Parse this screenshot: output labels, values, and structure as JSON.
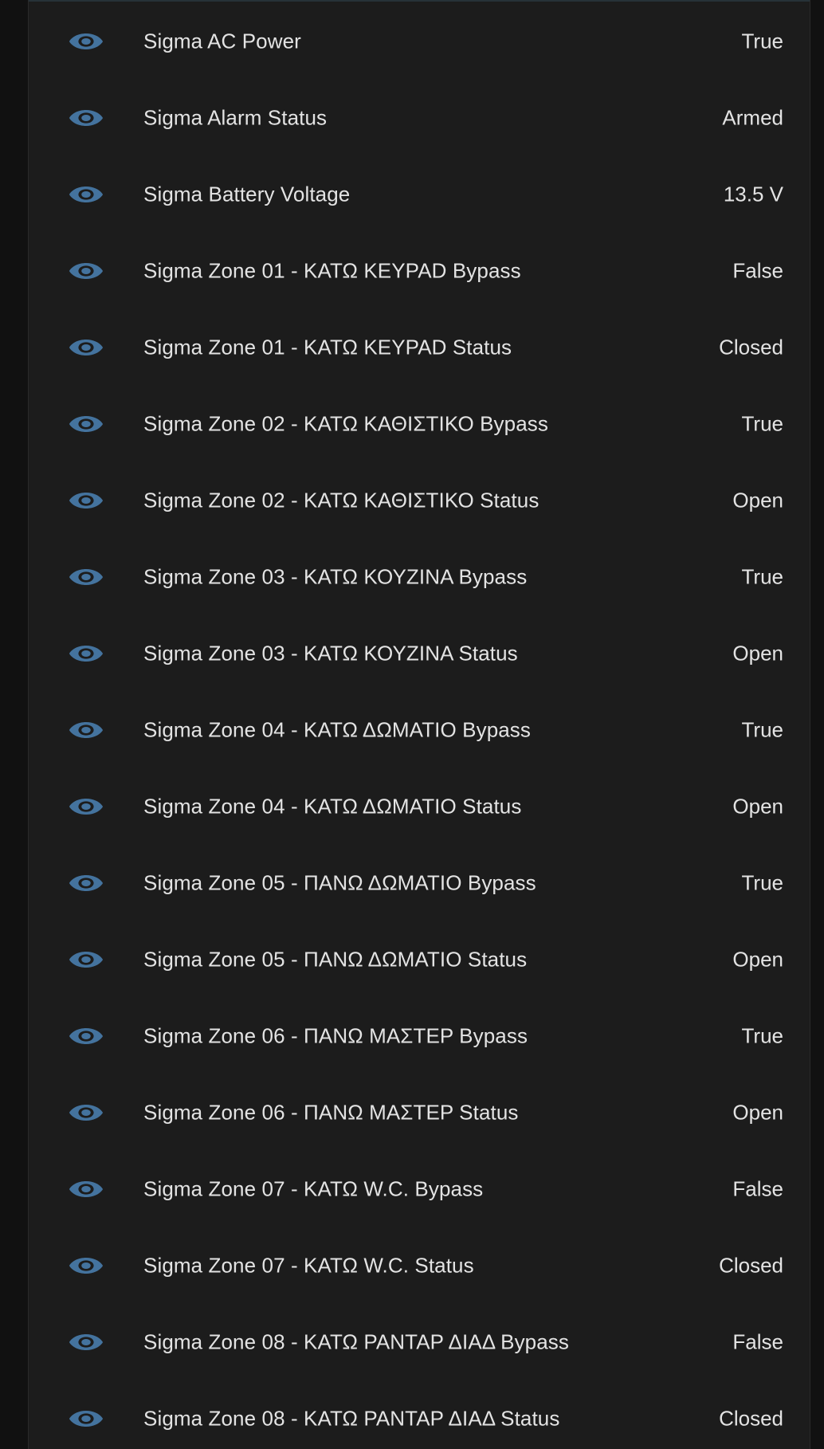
{
  "entities": [
    {
      "icon": "eye-icon",
      "name": "Sigma AC Power",
      "state": "True"
    },
    {
      "icon": "eye-icon",
      "name": "Sigma Alarm Status",
      "state": "Armed"
    },
    {
      "icon": "eye-icon",
      "name": "Sigma Battery Voltage",
      "state": "13.5 V"
    },
    {
      "icon": "eye-icon",
      "name": "Sigma Zone 01 - ΚΑΤΩ KEYPAD Bypass",
      "state": "False"
    },
    {
      "icon": "eye-icon",
      "name": "Sigma Zone 01 - ΚΑΤΩ KEYPAD Status",
      "state": "Closed"
    },
    {
      "icon": "eye-icon",
      "name": "Sigma Zone 02 - ΚΑΤΩ ΚΑΘΙΣΤΙΚΟ Bypass",
      "state": "True"
    },
    {
      "icon": "eye-icon",
      "name": "Sigma Zone 02 - ΚΑΤΩ ΚΑΘΙΣΤΙΚΟ Status",
      "state": "Open"
    },
    {
      "icon": "eye-icon",
      "name": "Sigma Zone 03 - ΚΑΤΩ ΚΟΥΖΙΝΑ Bypass",
      "state": "True"
    },
    {
      "icon": "eye-icon",
      "name": "Sigma Zone 03 - ΚΑΤΩ ΚΟΥΖΙΝΑ Status",
      "state": "Open"
    },
    {
      "icon": "eye-icon",
      "name": "Sigma Zone 04 - ΚΑΤΩ ΔΩΜΑΤΙΟ Bypass",
      "state": "True"
    },
    {
      "icon": "eye-icon",
      "name": "Sigma Zone 04 - ΚΑΤΩ ΔΩΜΑΤΙΟ Status",
      "state": "Open"
    },
    {
      "icon": "eye-icon",
      "name": "Sigma Zone 05 - ΠΑΝΩ ΔΩΜΑΤΙΟ Bypass",
      "state": "True"
    },
    {
      "icon": "eye-icon",
      "name": "Sigma Zone 05 - ΠΑΝΩ ΔΩΜΑΤΙΟ Status",
      "state": "Open"
    },
    {
      "icon": "eye-icon",
      "name": "Sigma Zone 06 - ΠΑΝΩ ΜΑΣΤΕΡ Bypass",
      "state": "True"
    },
    {
      "icon": "eye-icon",
      "name": "Sigma Zone 06 - ΠΑΝΩ ΜΑΣΤΕΡ Status",
      "state": "Open"
    },
    {
      "icon": "eye-icon",
      "name": "Sigma Zone 07 - ΚΑΤΩ W.C. Bypass",
      "state": "False"
    },
    {
      "icon": "eye-icon",
      "name": "Sigma Zone 07 - ΚΑΤΩ W.C. Status",
      "state": "Closed"
    },
    {
      "icon": "eye-icon",
      "name": "Sigma Zone 08 - ΚΑΤΩ ΡΑΝΤΑΡ ΔΙΑΔ Bypass",
      "state": "False"
    },
    {
      "icon": "eye-icon",
      "name": "Sigma Zone 08 - ΚΑΤΩ ΡΑΝΤΑΡ ΔΙΑΔ Status",
      "state": "Closed"
    }
  ],
  "colors": {
    "background": "#111111",
    "card": "#1c1c1c",
    "text": "#e3e3e3",
    "icon": "#44739e"
  }
}
